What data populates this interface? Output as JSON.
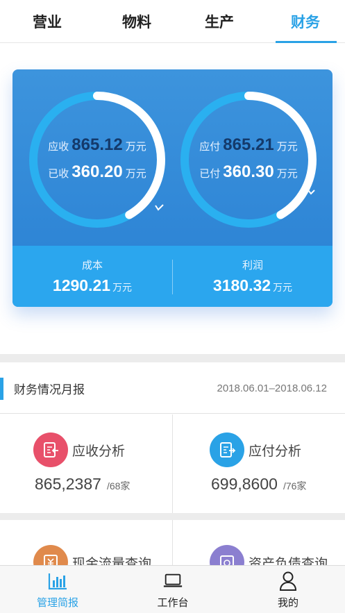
{
  "tabs": [
    {
      "label": "营业"
    },
    {
      "label": "物料"
    },
    {
      "label": "生产"
    },
    {
      "label": "财务",
      "active": true
    }
  ],
  "summary": {
    "receivable": {
      "due_label": "应收",
      "due_value": "865.12",
      "due_unit": "万元",
      "received_label": "已收",
      "received_value": "360.20",
      "received_unit": "万元",
      "progress": 0.416
    },
    "payable": {
      "due_label": "应付",
      "due_value": "865.21",
      "due_unit": "万元",
      "paid_label": "已付",
      "paid_value": "360.30",
      "paid_unit": "万元",
      "progress": 0.416
    },
    "cost": {
      "label": "成本",
      "value": "1290.21",
      "unit": "万元"
    },
    "profit": {
      "label": "利润",
      "value": "3180.32",
      "unit": "万元"
    }
  },
  "report": {
    "title": "财务情况月报",
    "date_range": "2018.06.01–2018.06.12"
  },
  "cards": [
    {
      "title": "应收分析",
      "value": "865,2387",
      "sub": "/68家",
      "color": "#e8506a",
      "icon": "receivable-doc-icon"
    },
    {
      "title": "应付分析",
      "value": "699,8600",
      "sub": "/76家",
      "color": "#2aa2e6",
      "icon": "payable-doc-icon"
    },
    {
      "title": "现金流量查询",
      "color": "#e08a4c",
      "icon": "cash-flow-icon"
    },
    {
      "title": "资产负债查询",
      "color": "#8b7fd0",
      "icon": "balance-sheet-icon"
    }
  ],
  "bottom_nav": [
    {
      "label": "管理简报",
      "icon": "bar-chart-icon",
      "active": true
    },
    {
      "label": "工作台",
      "icon": "laptop-icon"
    },
    {
      "label": "我的",
      "icon": "user-icon"
    }
  ],
  "colors": {
    "accent": "#2aa2e6",
    "hero": "#3d94dd",
    "hero_bottom": "#2ba6ee",
    "ring_track": "#2ab0f0",
    "ring_progress": "#ffffff"
  }
}
